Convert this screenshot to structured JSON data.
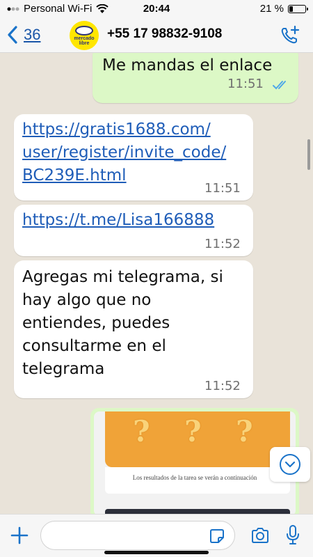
{
  "status_bar": {
    "carrier": "Personal Wi-Fi",
    "time": "20:44",
    "battery_text": "21 %",
    "battery_level": 0.21
  },
  "header": {
    "back_count": "36",
    "avatar_line1": "mercado",
    "avatar_line2": "libre",
    "contact_name": "+55 17 98832-9108",
    "icons": {
      "back": "chevron-left-icon",
      "call": "phone-add-icon"
    }
  },
  "messages": [
    {
      "direction": "out",
      "text": "Me mandas el enlace",
      "time": "11:51",
      "status": "read"
    },
    {
      "direction": "in",
      "type": "link",
      "lines": [
        "https://gratis1688.com/",
        "user/register/invite_code/",
        "BC239E.html"
      ],
      "time": "11:51"
    },
    {
      "direction": "in",
      "type": "link",
      "lines": [
        "https://t.me/Lisa166888"
      ],
      "time": "11:52"
    },
    {
      "direction": "in",
      "type": "text",
      "lines": [
        "Agregas mi telegrama, si",
        "hay algo que no",
        "entiendes, puedes",
        "consultarme en el",
        "telegrama"
      ],
      "time": "11:52"
    }
  ],
  "image_message": {
    "marks": [
      "?",
      "?",
      "?"
    ],
    "caption": "Los resultados de la tarea se verán a continuación"
  },
  "input": {
    "placeholder": "",
    "value": ""
  },
  "colors": {
    "outgoing_bubble": "#dcf8c6",
    "incoming_bubble": "#ffffff",
    "link": "#1f5db8",
    "accent": "#1a73c9",
    "chat_bg": "#e9e3d9"
  }
}
